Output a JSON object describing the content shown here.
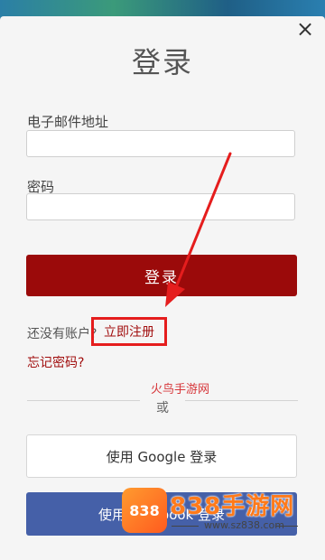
{
  "dialog": {
    "title": "登录",
    "close_glyph": "×"
  },
  "form": {
    "email_label": "电子邮件地址",
    "email_value": "",
    "password_label": "密码",
    "password_value": "",
    "login_button": "登录"
  },
  "register": {
    "prompt": "还没有账户?",
    "link": "立即注册"
  },
  "forgot": "忘记密码?",
  "divider": "或",
  "social": {
    "google_button": "使用 Google 登录",
    "facebook_button": "使用 Facebook 登录"
  },
  "watermark": {
    "red_text": "火鸟手游网",
    "logo_text": "838",
    "brand": "838手游网",
    "url": "www.sz838.com"
  },
  "colors": {
    "primary": "#9b0a0a",
    "link": "#a10e0e",
    "highlight": "#e51d1d",
    "facebook": "#4560a8"
  },
  "icons": {
    "close": "close-icon",
    "annotation": "red-arrow-icon"
  }
}
